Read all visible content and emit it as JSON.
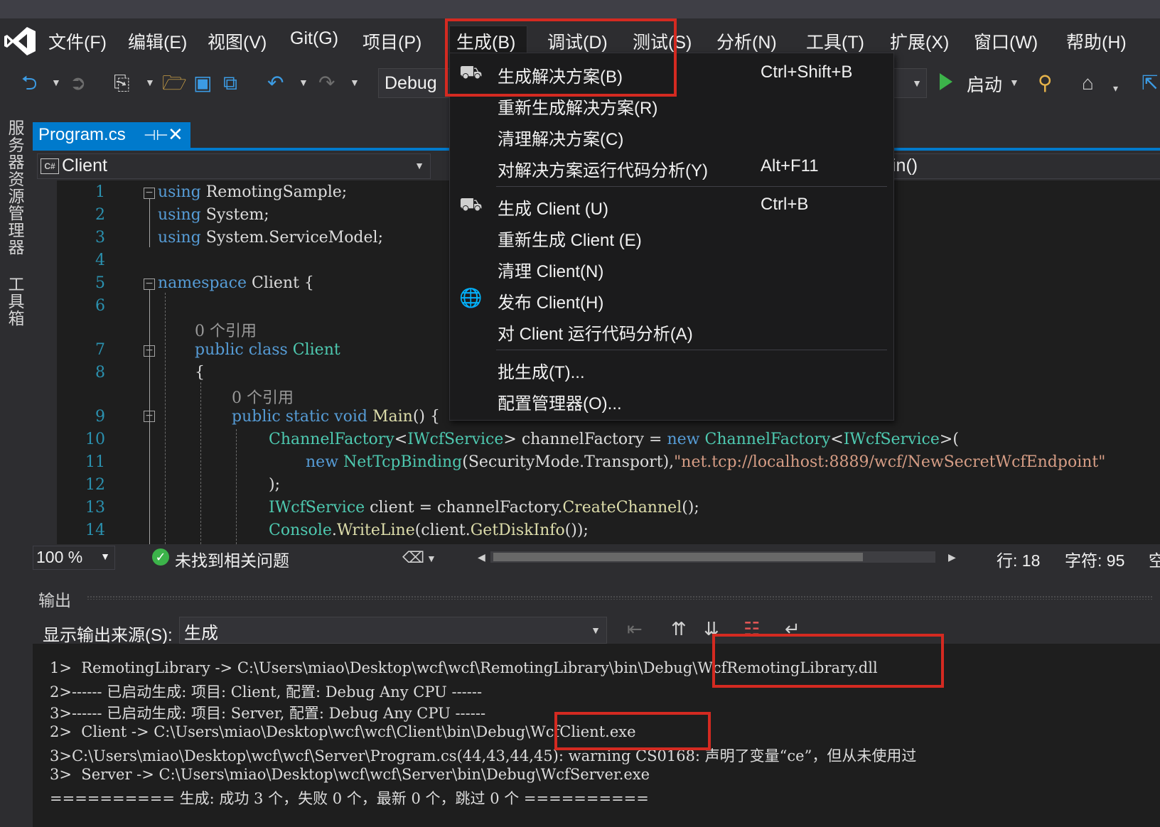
{
  "menubar": {
    "items": [
      "文件(F)",
      "编辑(E)",
      "视图(V)",
      "Git(G)",
      "项目(P)",
      "生成(B)",
      "调试(D)",
      "测试(S)",
      "分析(N)",
      "工具(T)",
      "扩展(X)",
      "窗口(W)",
      "帮助(H)"
    ]
  },
  "toolbar": {
    "configuration": "Debug",
    "start_label": "启动"
  },
  "sidebar": {
    "tabs": [
      "服务器资源管理器",
      "工具箱"
    ]
  },
  "document_tab": {
    "title": "Program.cs",
    "pin_icon": "pin-icon",
    "close_icon": "close-icon"
  },
  "navbar": {
    "project": "Client",
    "member": "in()"
  },
  "editor": {
    "line_numbers": [
      "1",
      "2",
      "3",
      "4",
      "5",
      "6",
      "7",
      "8",
      "9",
      "10",
      "11",
      "12",
      "13",
      "14"
    ],
    "code_lens": "0 个引用",
    "lines": {
      "l1": {
        "kw": "using",
        "rest": " RemotingSample;"
      },
      "l2": {
        "kw": "using",
        "rest": " System;"
      },
      "l3": {
        "kw": "using",
        "rest": " System.ServiceModel;"
      },
      "l5": {
        "kw": "namespace",
        "rest": " Client {"
      },
      "l7": {
        "kw": "public class",
        "ty": "Client"
      },
      "l8": "{",
      "l9": {
        "kw": "public static void",
        "mt": "Main",
        "rest": "() {"
      },
      "l10": {
        "ty1": "ChannelFactory",
        "p1": "<",
        "ty2": "IWcfService",
        "p2": "> channelFactory = ",
        "kw": "new",
        "ty3": "ChannelFactory",
        "p3": "<",
        "ty4": "IWcfService",
        "p4": ">("
      },
      "l11": {
        "kw": "new",
        "ty": "NetTcpBinding",
        "p1": "(SecurityMode.Transport),",
        "str": "\"net.tcp://localhost:8889/wcf/NewSecretWcfEndpoint\""
      },
      "l12": ");",
      "l13": {
        "ty": "IWcfService",
        "p1": " client = channelFactory.",
        "mt": "CreateChannel",
        "p2": "();"
      },
      "l14": {
        "ty": "Console",
        "p1": ".",
        "mt": "WriteLine",
        "p2": "(client.",
        "mt2": "GetDiskInfo",
        "p3": "());"
      }
    }
  },
  "editor_status": {
    "zoom": "100 %",
    "issues": "未找到相关问题",
    "row": "行: 18",
    "col": "字符: 95",
    "extra": "空"
  },
  "output": {
    "title": "输出",
    "source_label": "显示输出来源(S):",
    "source_value": "生成",
    "lines": [
      "1>  RemotingLibrary -> C:\\Users\\miao\\Desktop\\wcf\\wcf\\RemotingLibrary\\bin\\Debug\\WcfRemotingLibrary.dll",
      "2>------ 已启动生成: 项目: Client, 配置: Debug Any CPU ------",
      "3>------ 已启动生成: 项目: Server, 配置: Debug Any CPU ------",
      "2>  Client -> C:\\Users\\miao\\Desktop\\wcf\\wcf\\Client\\bin\\Debug\\WcfClient.exe",
      "3>C:\\Users\\miao\\Desktop\\wcf\\wcf\\Server\\Program.cs(44,43,44,45): warning CS0168: 声明了变量“ce”，但从未使用过",
      "3>  Server -> C:\\Users\\miao\\Desktop\\wcf\\wcf\\Server\\bin\\Debug\\WcfServer.exe",
      "========== 生成: 成功 3 个，失败 0 个，最新 0 个，跳过 0 个 =========="
    ]
  },
  "build_menu": {
    "items": [
      {
        "label": "生成解决方案(B)",
        "shortcut": "Ctrl+Shift+B",
        "icon": "build-icon"
      },
      {
        "label": "重新生成解决方案(R)",
        "shortcut": ""
      },
      {
        "label": "清理解决方案(C)",
        "shortcut": ""
      },
      {
        "label": "对解决方案运行代码分析(Y)",
        "shortcut": "Alt+F11"
      },
      {
        "label": "生成 Client (U)",
        "shortcut": "Ctrl+B",
        "icon": "build-icon"
      },
      {
        "label": "重新生成 Client (E)",
        "shortcut": ""
      },
      {
        "label": "清理 Client(N)",
        "shortcut": ""
      },
      {
        "label": "发布 Client(H)",
        "shortcut": "",
        "icon": "globe-publish-icon"
      },
      {
        "label": "对 Client 运行代码分析(A)",
        "shortcut": ""
      },
      {
        "label": "批生成(T)...",
        "shortcut": ""
      },
      {
        "label": "配置管理器(O)...",
        "shortcut": ""
      }
    ]
  },
  "colors": {
    "accent": "#007acc",
    "highlight_box": "#d42a21",
    "keyword": "#569cd6",
    "type": "#4ec9b0"
  }
}
